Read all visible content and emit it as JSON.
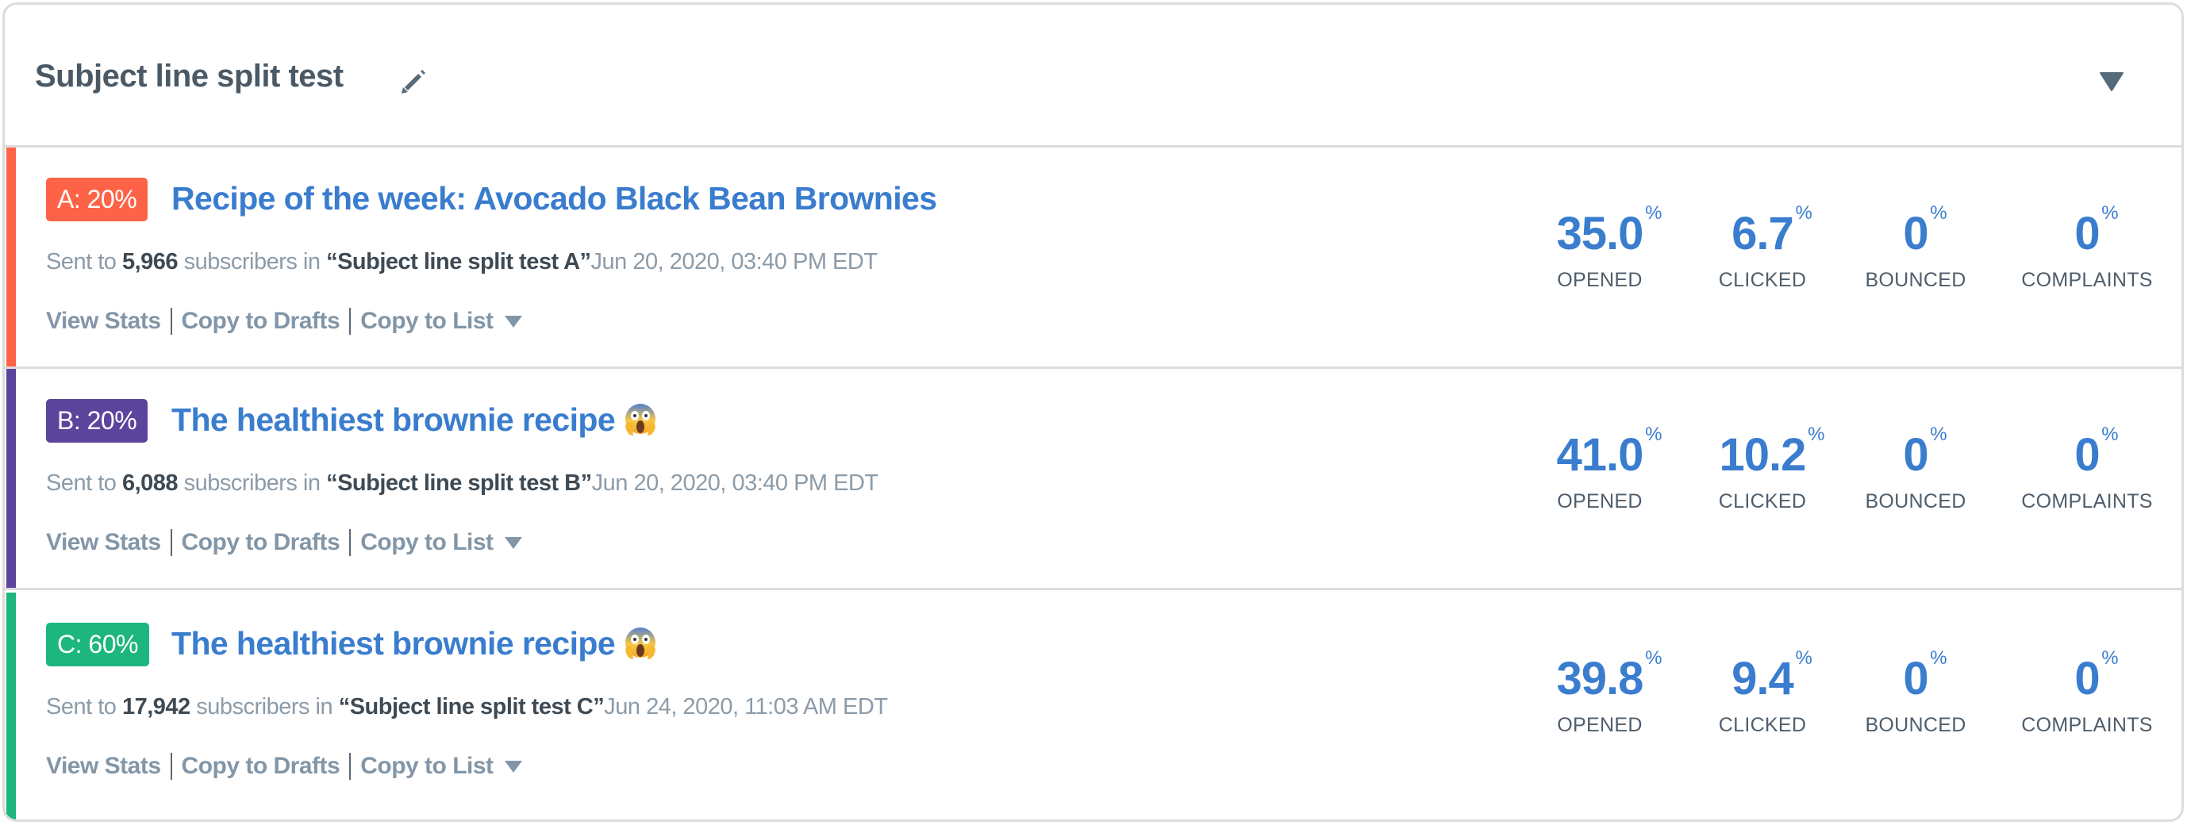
{
  "header": {
    "title": "Subject line split test",
    "edit_icon": "pencil-icon",
    "collapse_icon": "caret-down-icon"
  },
  "variants": [
    {
      "badge": "A: 20%",
      "color": "#ff6347",
      "title": "Recipe of the week: Avocado Black Bean Brownies",
      "emoji": "",
      "meta": {
        "prefix": "Sent to ",
        "count": "5,966",
        "middle": " subscribers in ",
        "list": "“Subject line split test A”",
        "date": "Jun 20, 2020, 03:40 PM EDT"
      },
      "links": {
        "view_stats": "View Stats",
        "copy_drafts": "Copy to Drafts",
        "copy_list": "Copy to List"
      },
      "stats": [
        {
          "value": "35.0",
          "unit": "%",
          "label": "OPENED"
        },
        {
          "value": "6.7",
          "unit": "%",
          "label": "CLICKED"
        },
        {
          "value": "0",
          "unit": "%",
          "label": "BOUNCED"
        },
        {
          "value": "0",
          "unit": "%",
          "label": "COMPLAINTS"
        }
      ]
    },
    {
      "badge": "B: 20%",
      "color": "#5b449b",
      "title": "The healthiest brownie recipe",
      "emoji": "😱",
      "meta": {
        "prefix": "Sent to ",
        "count": "6,088",
        "middle": " subscribers in ",
        "list": "“Subject line split test B”",
        "date": "Jun 20, 2020, 03:40 PM EDT"
      },
      "links": {
        "view_stats": "View Stats",
        "copy_drafts": "Copy to Drafts",
        "copy_list": "Copy to List"
      },
      "stats": [
        {
          "value": "41.0",
          "unit": "%",
          "label": "OPENED"
        },
        {
          "value": "10.2",
          "unit": "%",
          "label": "CLICKED"
        },
        {
          "value": "0",
          "unit": "%",
          "label": "BOUNCED"
        },
        {
          "value": "0",
          "unit": "%",
          "label": "COMPLAINTS"
        }
      ]
    },
    {
      "badge": "C: 60%",
      "color": "#1cb67e",
      "title": "The healthiest brownie recipe",
      "emoji": "😱",
      "meta": {
        "prefix": "Sent to ",
        "count": "17,942",
        "middle": " subscribers in ",
        "list": "“Subject line split test C”",
        "date": "Jun 24, 2020, 11:03 AM EDT"
      },
      "links": {
        "view_stats": "View Stats",
        "copy_drafts": "Copy to Drafts",
        "copy_list": "Copy to List"
      },
      "stats": [
        {
          "value": "39.8",
          "unit": "%",
          "label": "OPENED"
        },
        {
          "value": "9.4",
          "unit": "%",
          "label": "CLICKED"
        },
        {
          "value": "0",
          "unit": "%",
          "label": "BOUNCED"
        },
        {
          "value": "0",
          "unit": "%",
          "label": "COMPLAINTS"
        }
      ]
    }
  ]
}
